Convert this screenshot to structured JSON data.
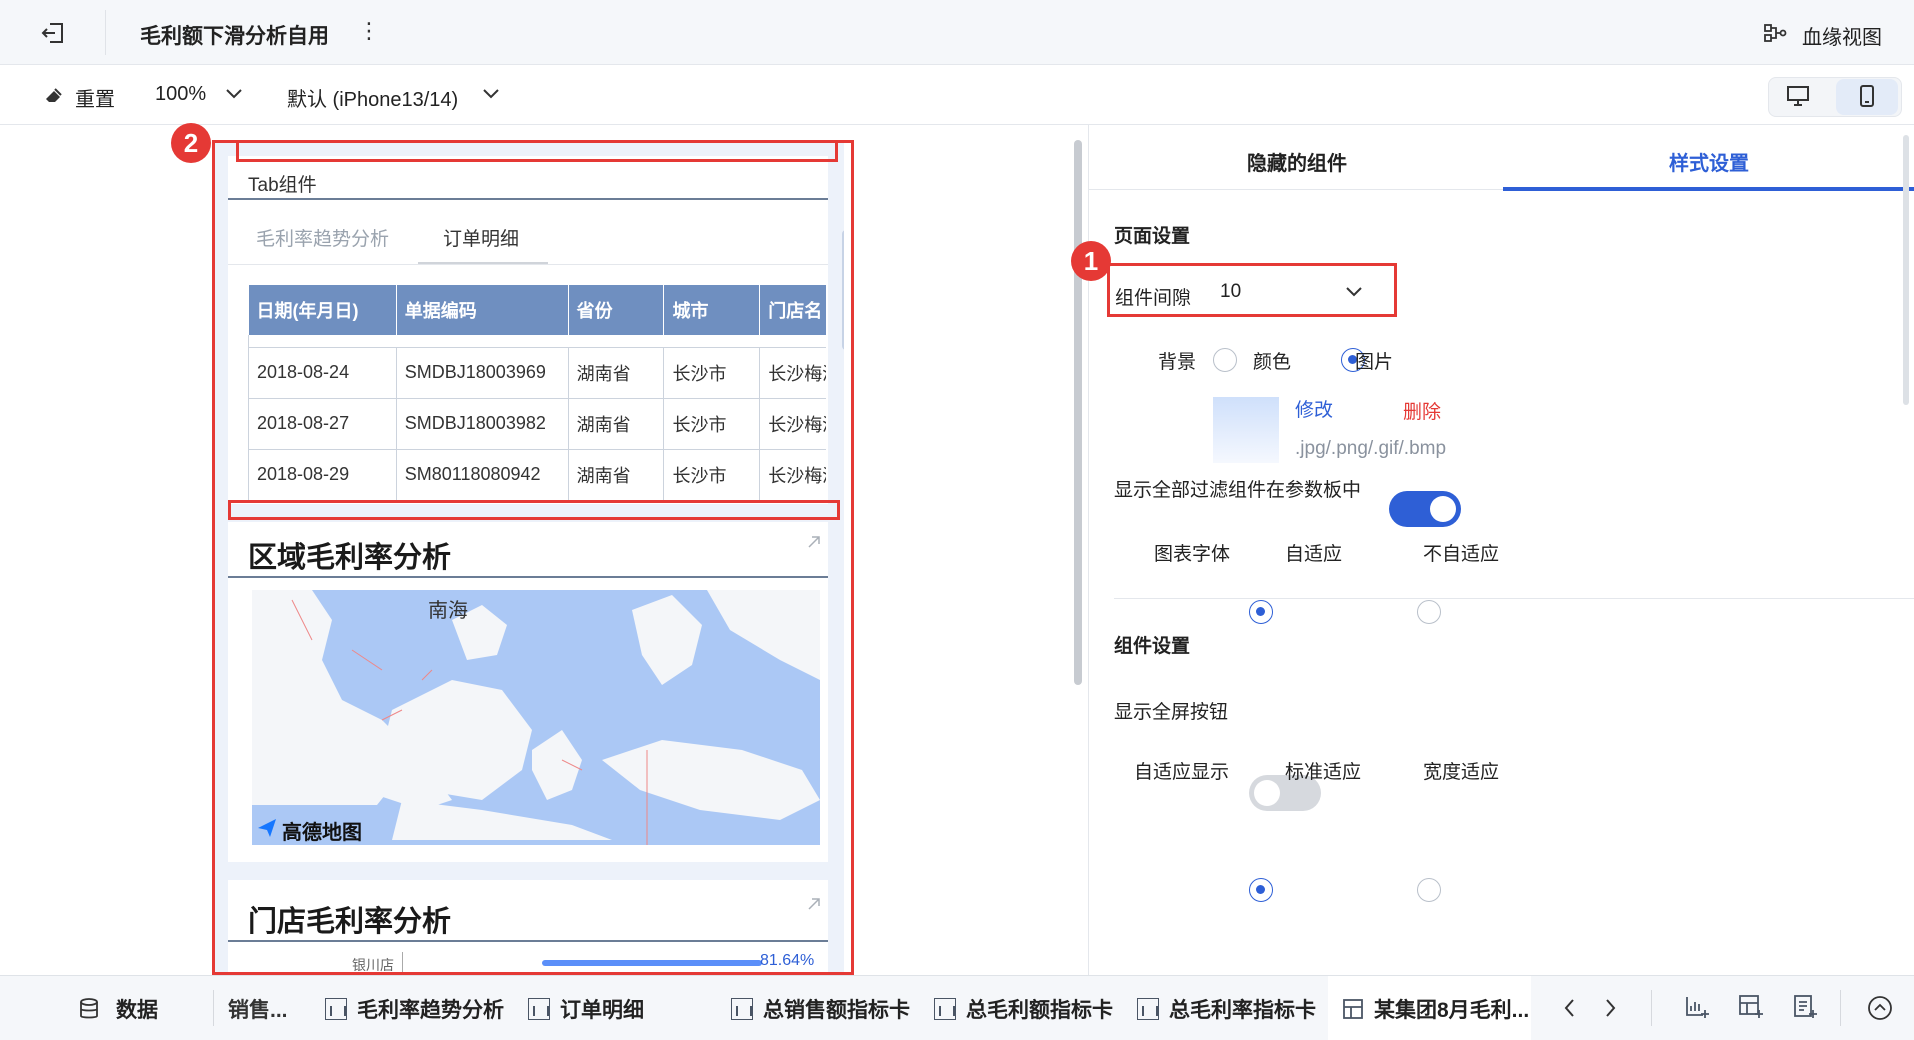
{
  "header": {
    "title": "毛利额下滑分析自用",
    "more_icon": "⋮",
    "lineage_label": "血缘视图"
  },
  "toolbar": {
    "reset_label": "重置",
    "zoom": "100%",
    "device": "默认 (iPhone13/14)"
  },
  "canvas": {
    "badge_2": "2",
    "tab_component_label": "Tab组件",
    "tabs": [
      "毛利率趋势分析",
      "订单明细"
    ],
    "table": {
      "headers": [
        "日期(年月日)",
        "单据编码",
        "省份",
        "城市",
        "门店名"
      ],
      "rows": [
        [
          "2018-08-24",
          "SMDBJ18003969",
          "湖南省",
          "长沙市",
          "长沙梅溪"
        ],
        [
          "2018-08-27",
          "SMDBJ18003982",
          "湖南省",
          "长沙市",
          "长沙梅溪"
        ],
        [
          "2018-08-29",
          "SM80118080942",
          "湖南省",
          "长沙市",
          "长沙梅溪"
        ]
      ]
    },
    "region_title": "区域毛利率分析",
    "map_label": "南海",
    "map_logo": "高德地图",
    "store_title": "门店毛利率分析",
    "store_row_label": "银川店",
    "store_row_value": "81.64%",
    "store_row_value_fraction": 0.8164
  },
  "panel": {
    "tabs": [
      "隐藏的组件",
      "样式设置"
    ],
    "badge_1": "1",
    "page_settings": "页面设置",
    "gap_label": "组件间隙",
    "gap_value": "10",
    "background_label": "背景",
    "bg_color": "颜色",
    "bg_image": "图片",
    "modify": "修改",
    "delete": "删除",
    "formats": ".jpg/.png/.gif/.bmp",
    "show_filter_label": "显示全部过滤组件在参数板中",
    "chart_font_label": "图表字体",
    "adaptive": "自适应",
    "non_adaptive": "不自适应",
    "component_settings": "组件设置",
    "fullscreen_label": "显示全屏按钮",
    "adaptive_display_label": "自适应显示",
    "standard_fit": "标准适应",
    "width_fit": "宽度适应"
  },
  "bottom": {
    "data_label": "数据",
    "tabs": [
      "销售...",
      "毛利率趋势分析",
      "订单明细",
      "总销售额指标卡",
      "总毛利额指标卡",
      "总毛利率指标卡",
      "某集团8月毛利..."
    ]
  },
  "colors": {
    "accent": "#2e5fd6",
    "highlight_red": "#e53935",
    "table_header": "#6f8fc0",
    "map_water": "#abc8f5"
  }
}
